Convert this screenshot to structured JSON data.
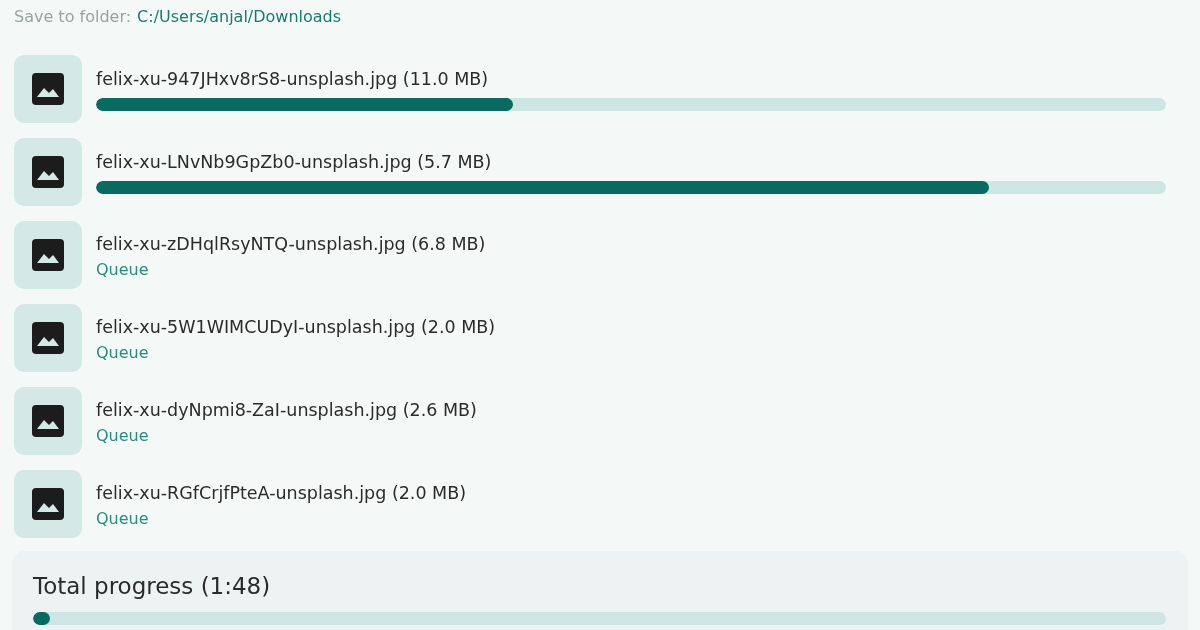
{
  "save_folder": {
    "label": "Save to folder:",
    "path": "C:/Users/anjal/Downloads"
  },
  "downloads": [
    {
      "kind": "progress",
      "name": "felix-xu-947JHxv8rS8-unsplash.jpg (11.0 MB)",
      "level": 0.39
    },
    {
      "kind": "progress",
      "name": "felix-xu-LNvNb9GpZb0-unsplash.jpg (5.7 MB)",
      "level": 0.835
    },
    {
      "kind": "status",
      "name": "felix-xu-zDHqlRsyNTQ-unsplash.jpg (6.8 MB)",
      "status": "Queue"
    },
    {
      "kind": "status",
      "name": "felix-xu-5W1WIMCUDyI-unsplash.jpg (2.0 MB)",
      "status": "Queue"
    },
    {
      "kind": "status",
      "name": "felix-xu-dyNpmi8-ZaI-unsplash.jpg (2.6 MB)",
      "status": "Queue"
    },
    {
      "kind": "status",
      "name": "felix-xu-RGfCrjfPteA-unsplash.jpg (2.0 MB)",
      "status": "Queue"
    }
  ],
  "total": {
    "label": "Total progress (1:48)",
    "level": 0.015
  }
}
